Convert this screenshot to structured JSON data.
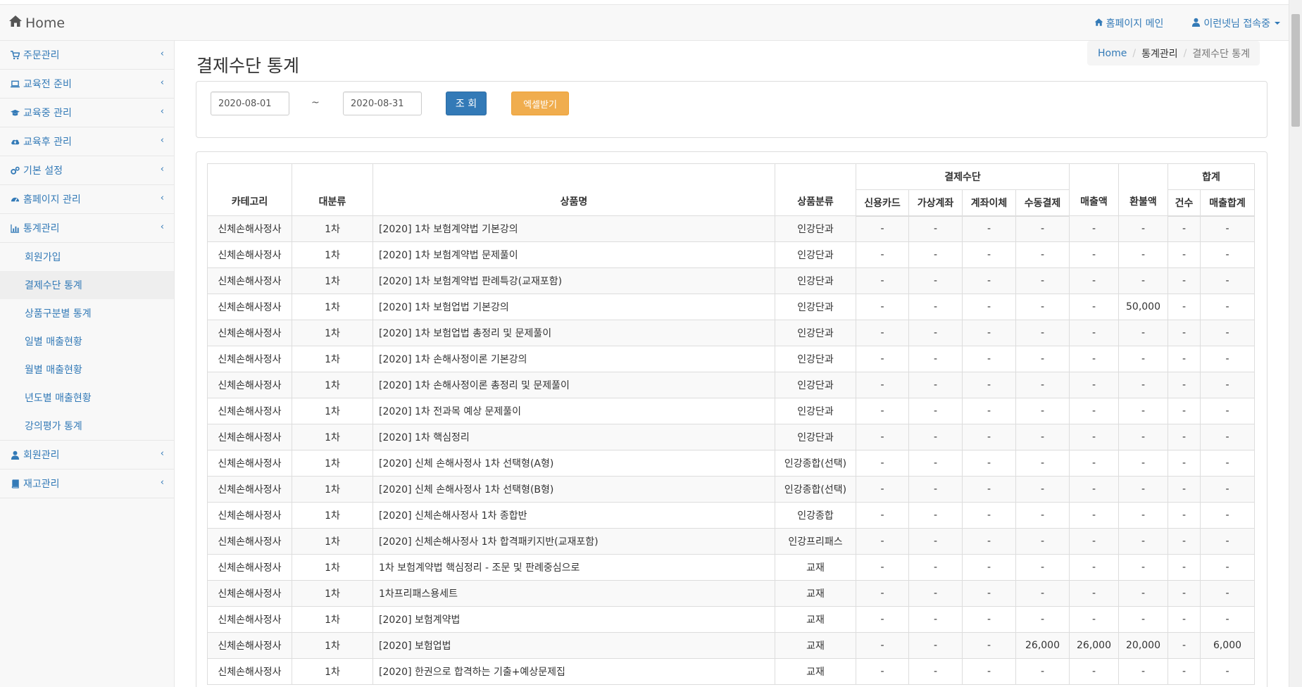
{
  "navbar": {
    "brand": "Home",
    "home_link": "홈페이지 메인",
    "user_link": "이런넷님 접속중"
  },
  "sidebar": {
    "items": [
      {
        "label": "주문관리",
        "icon": "cart-icon"
      },
      {
        "label": "교육전 준비",
        "icon": "laptop-icon"
      },
      {
        "label": "교육중 관리",
        "icon": "graduation-cap-icon"
      },
      {
        "label": "교육후 관리",
        "icon": "cloud-upload-icon"
      },
      {
        "label": "기본 설정",
        "icon": "gears-icon"
      },
      {
        "label": "홈페이지 관리",
        "icon": "dashboard-icon"
      },
      {
        "label": "통계관리",
        "icon": "bar-chart-icon"
      }
    ],
    "sub_items": [
      "회원가입",
      "결제수단 통계",
      "상품구분별 통계",
      "일별 매출현황",
      "월별 매출현황",
      "년도별 매출현황",
      "강의평가 통계"
    ],
    "bottom_items": [
      {
        "label": "회원관리",
        "icon": "user-icon"
      },
      {
        "label": "재고관리",
        "icon": "book-icon"
      }
    ],
    "chevron": "‹"
  },
  "page": {
    "title": "결제수단 통계",
    "breadcrumb": [
      "Home",
      "통계관리",
      "결제수단 통계"
    ]
  },
  "search": {
    "start_date": "2020-08-01",
    "tilde": "~",
    "end_date": "2020-08-31",
    "search_button": "조 회",
    "excel_button": "엑셀받기"
  },
  "table": {
    "headers": {
      "category": "카테고리",
      "major": "대분류",
      "product": "상품명",
      "product_type": "상품분류",
      "payment_group": "결제수단",
      "credit_card": "신용카드",
      "virtual_account": "가상계좌",
      "transfer": "계좌이체",
      "manual": "수동결제",
      "sales": "매출액",
      "refund": "환불액",
      "total_group": "합계",
      "count": "건수",
      "sales_total": "매출합계"
    },
    "rows": [
      [
        "신체손해사정사",
        "1차",
        "[2020] 1차 보험계약법 기본강의",
        "인강단과",
        "-",
        "-",
        "-",
        "-",
        "-",
        "-",
        "-",
        "-"
      ],
      [
        "신체손해사정사",
        "1차",
        "[2020] 1차 보험계약법 문제풀이",
        "인강단과",
        "-",
        "-",
        "-",
        "-",
        "-",
        "-",
        "-",
        "-"
      ],
      [
        "신체손해사정사",
        "1차",
        "[2020] 1차 보험계약법 판례특강(교재포함)",
        "인강단과",
        "-",
        "-",
        "-",
        "-",
        "-",
        "-",
        "-",
        "-"
      ],
      [
        "신체손해사정사",
        "1차",
        "[2020] 1차 보험업법 기본강의",
        "인강단과",
        "-",
        "-",
        "-",
        "-",
        "-",
        "50,000",
        "-",
        "-"
      ],
      [
        "신체손해사정사",
        "1차",
        "[2020] 1차 보험업법 총정리 및 문제풀이",
        "인강단과",
        "-",
        "-",
        "-",
        "-",
        "-",
        "-",
        "-",
        "-"
      ],
      [
        "신체손해사정사",
        "1차",
        "[2020] 1차 손해사정이론 기본강의",
        "인강단과",
        "-",
        "-",
        "-",
        "-",
        "-",
        "-",
        "-",
        "-"
      ],
      [
        "신체손해사정사",
        "1차",
        "[2020] 1차 손해사정이론 총정리 및 문제풀이",
        "인강단과",
        "-",
        "-",
        "-",
        "-",
        "-",
        "-",
        "-",
        "-"
      ],
      [
        "신체손해사정사",
        "1차",
        "[2020] 1차 전과목 예상 문제풀이",
        "인강단과",
        "-",
        "-",
        "-",
        "-",
        "-",
        "-",
        "-",
        "-"
      ],
      [
        "신체손해사정사",
        "1차",
        "[2020] 1차 핵심정리",
        "인강단과",
        "-",
        "-",
        "-",
        "-",
        "-",
        "-",
        "-",
        "-"
      ],
      [
        "신체손해사정사",
        "1차",
        "[2020] 신체 손해사정사 1차 선택형(A형)",
        "인강종합(선택)",
        "-",
        "-",
        "-",
        "-",
        "-",
        "-",
        "-",
        "-"
      ],
      [
        "신체손해사정사",
        "1차",
        "[2020] 신체 손해사정사 1차 선택형(B형)",
        "인강종합(선택)",
        "-",
        "-",
        "-",
        "-",
        "-",
        "-",
        "-",
        "-"
      ],
      [
        "신체손해사정사",
        "1차",
        "[2020] 신체손해사정사 1차 종합반",
        "인강종합",
        "-",
        "-",
        "-",
        "-",
        "-",
        "-",
        "-",
        "-"
      ],
      [
        "신체손해사정사",
        "1차",
        "[2020] 신체손해사정사 1차 합격패키지반(교재포함)",
        "인강프리패스",
        "-",
        "-",
        "-",
        "-",
        "-",
        "-",
        "-",
        "-"
      ],
      [
        "신체손해사정사",
        "1차",
        "1차 보험계약법 핵심정리 - 조문 및 판례중심으로",
        "교재",
        "-",
        "-",
        "-",
        "-",
        "-",
        "-",
        "-",
        "-"
      ],
      [
        "신체손해사정사",
        "1차",
        "1차프리패스용세트",
        "교재",
        "-",
        "-",
        "-",
        "-",
        "-",
        "-",
        "-",
        "-"
      ],
      [
        "신체손해사정사",
        "1차",
        "[2020] 보험계약법",
        "교재",
        "-",
        "-",
        "-",
        "-",
        "-",
        "-",
        "-",
        "-"
      ],
      [
        "신체손해사정사",
        "1차",
        "[2020] 보험업법",
        "교재",
        "-",
        "-",
        "-",
        "26,000",
        "26,000",
        "20,000",
        "-",
        "6,000"
      ],
      [
        "신체손해사정사",
        "1차",
        "[2020] 한권으로 합격하는 기출+예상문제집",
        "교재",
        "-",
        "-",
        "-",
        "-",
        "-",
        "-",
        "-",
        "-"
      ]
    ]
  },
  "colors": {
    "link": "#337ab7",
    "primary_button": "#337ab7",
    "warning_button": "#f0ad4e"
  }
}
